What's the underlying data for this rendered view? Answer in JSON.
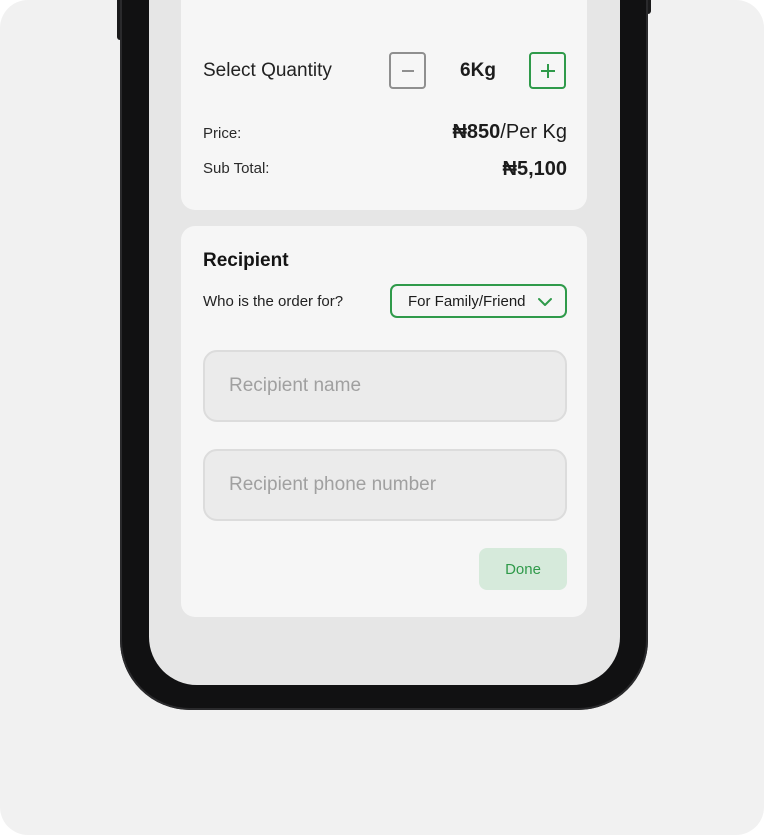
{
  "quantity": {
    "label": "Select Quantity",
    "value": "6Kg",
    "minus_icon": "minus-icon",
    "plus_icon": "plus-icon"
  },
  "pricing": {
    "price_label": "Price:",
    "price_amount": "₦850",
    "price_unit": "/Per Kg",
    "subtotal_label": "Sub Total:",
    "subtotal_value": "₦5,100"
  },
  "recipient": {
    "title": "Recipient",
    "question": "Who is the order for?",
    "selected_option": "For Family/Friend",
    "name_placeholder": "Recipient name",
    "phone_placeholder": "Recipient phone number",
    "done_label": "Done"
  },
  "colors": {
    "accent_green": "#2f9a4a",
    "done_bg": "#d6eadb",
    "card_bg": "#f6f6f6",
    "phone_frame": "#111112"
  }
}
